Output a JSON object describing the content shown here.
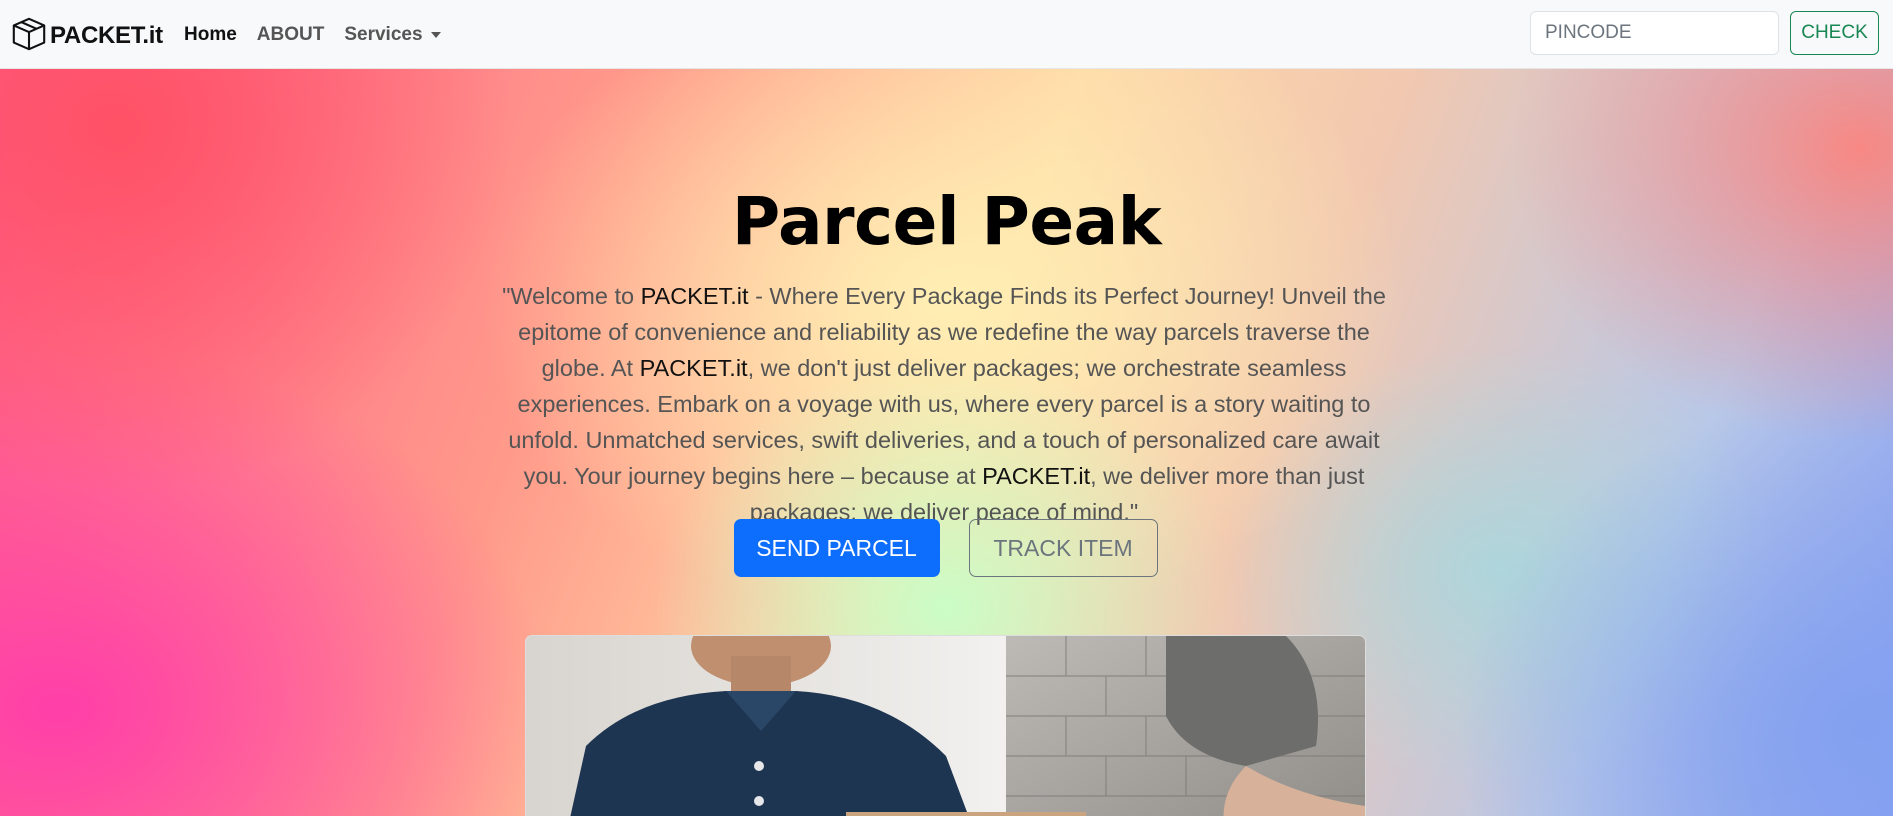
{
  "brand": {
    "name": "PACKET.it",
    "icon": "package-box-icon"
  },
  "nav": {
    "items": [
      {
        "label": "Home",
        "active": true
      },
      {
        "label": "ABOUT",
        "active": false
      },
      {
        "label": "Services",
        "active": false,
        "dropdown": true
      }
    ]
  },
  "search": {
    "placeholder": "PINCODE",
    "value": "",
    "button_label": "CHECK"
  },
  "hero": {
    "title": "Parcel Peak",
    "text_parts": [
      "\"Welcome to ",
      "PACKET.it",
      " - Where Every Package Finds its Perfect Journey! Unveil the epitome of convenience and reliability as we redefine the way parcels traverse the globe. At ",
      "PACKET.it",
      ", we don't just deliver packages; we orchestrate seamless experiences. Embark on a voyage with us, where every parcel is a story waiting to unfold. Unmatched services, swift deliveries, and a touch of personalized care await you. Your journey begins here – because at ",
      "PACKET.it",
      ", we deliver more than just packages; we deliver peace of mind.\""
    ],
    "primary_button": "SEND PARCEL",
    "secondary_button": "TRACK ITEM"
  },
  "colors": {
    "primary": "#0d6efd",
    "success": "#198754",
    "secondary": "#6c757d",
    "navbar_bg": "#f8f9fa"
  }
}
